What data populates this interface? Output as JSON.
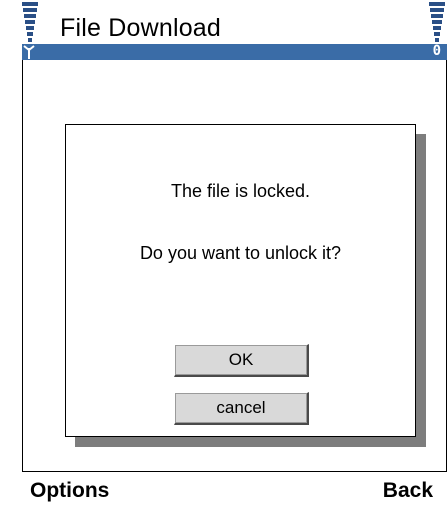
{
  "header": {
    "title": "File Download",
    "battery_digit": "0"
  },
  "dialog": {
    "message_line1": "The file is locked.",
    "message_line2": "Do you want to unlock it?",
    "ok_label": "OK",
    "cancel_label": "cancel"
  },
  "softkeys": {
    "left_label": "Options",
    "right_label": "Back"
  },
  "colors": {
    "header_bar": "#3a6ca7",
    "dialog_shadow": "#7d7d7d",
    "button_face": "#d9d9d9"
  },
  "icons": {
    "signal": "signal-strength-icon",
    "antenna": "antenna-icon",
    "battery": "battery-level-icon"
  }
}
